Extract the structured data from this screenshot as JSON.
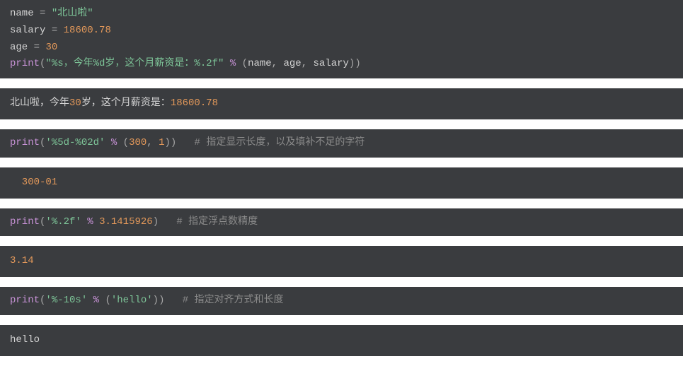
{
  "block1": {
    "line1": {
      "var": "name",
      "eq": " = ",
      "str": "\"北山啦\""
    },
    "line2": {
      "var": "salary",
      "eq": " = ",
      "num": "18600.78"
    },
    "line3": {
      "var": "age",
      "eq": " = ",
      "num": "30"
    },
    "line4": {
      "func": "print",
      "lp": "(",
      "str": "\"%s，今年%d岁，这个月薪资是：%.2f\"",
      "sp1": " ",
      "pct": "%",
      "sp2": " ",
      "lp2": "(",
      "a1": "name",
      "c1": ", ",
      "a2": "age",
      "c2": ", ",
      "a3": "salary",
      "rp2": ")",
      "rp": ")"
    }
  },
  "out1": {
    "pre": "北山啦，今年",
    "n1": "30",
    "mid": "岁，这个月薪资是：",
    "n2": "18600.78"
  },
  "block2": {
    "func": "print",
    "lp": "(",
    "str": "'%5d-%02d'",
    "sp1": " ",
    "pct": "%",
    "sp2": " ",
    "lp2": "(",
    "a1": "300",
    "c1": ", ",
    "a2": "1",
    "rp2": ")",
    "rp": ")",
    "gap": "   ",
    "cmt": "# 指定显示长度，以及填补不足的字符"
  },
  "out2": {
    "text": "  300-01"
  },
  "block3": {
    "func": "print",
    "lp": "(",
    "str": "'%.2f'",
    "sp1": " ",
    "pct": "%",
    "sp2": " ",
    "num": "3.1415926",
    "rp": ")",
    "gap": "   ",
    "cmt": "# 指定浮点数精度"
  },
  "out3": {
    "text": "3.14"
  },
  "block4": {
    "func": "print",
    "lp": "(",
    "str": "'%-10s'",
    "sp1": " ",
    "pct": "%",
    "sp2": " ",
    "lp2": "(",
    "arg": "'hello'",
    "rp2": ")",
    "rp": ")",
    "gap": "   ",
    "cmt": "# 指定对齐方式和长度"
  },
  "out4": {
    "text": "hello     "
  }
}
